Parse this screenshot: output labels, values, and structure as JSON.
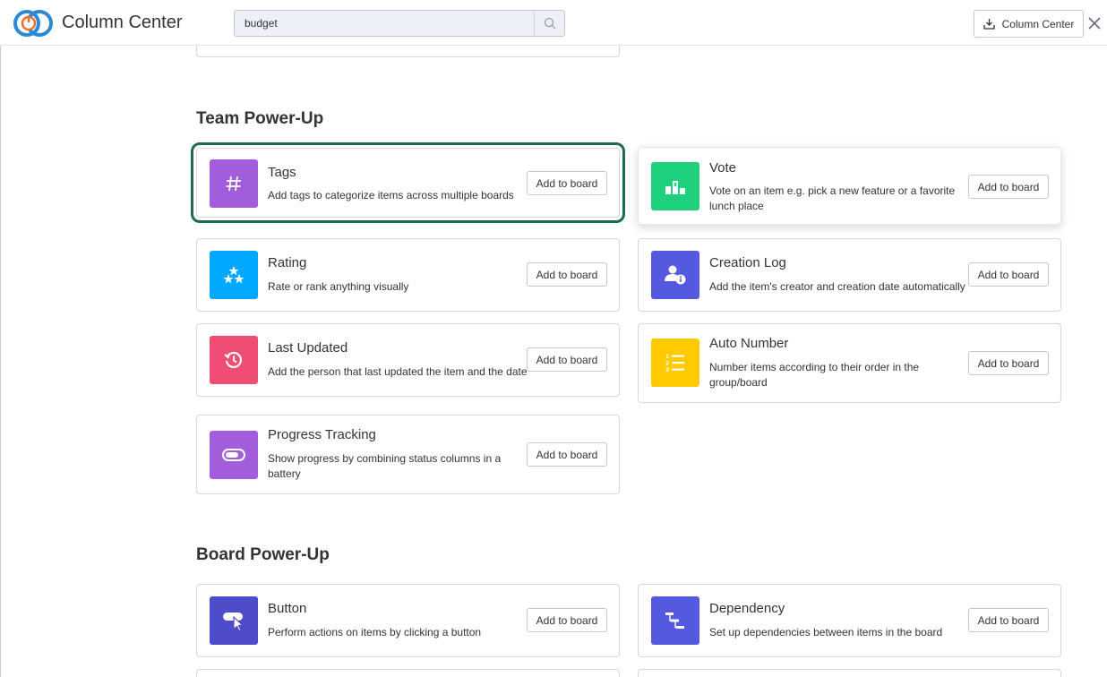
{
  "header": {
    "app_title": "Column Center",
    "search_value": "budget",
    "column_center_button": "Column Center"
  },
  "sections": {
    "team": {
      "title": "Team Power-Up"
    },
    "board": {
      "title": "Board Power-Up"
    }
  },
  "cards": {
    "tags": {
      "title": "Tags",
      "desc": "Add tags to categorize items across multiple boards",
      "button": "Add to board",
      "icon": "hash-icon",
      "color": "#a25ddc"
    },
    "vote": {
      "title": "Vote",
      "desc": "Vote on an item e.g. pick a new feature or a favorite lunch place",
      "button": "Add to board",
      "icon": "podium-icon",
      "color": "#1fd17d"
    },
    "rating": {
      "title": "Rating",
      "desc": "Rate or rank anything visually",
      "button": "Add to board",
      "icon": "stars-icon",
      "color": "#00a9ff"
    },
    "creation_log": {
      "title": "Creation Log",
      "desc": "Add the item's creator and creation date automatically",
      "button": "Add to board",
      "icon": "user-info-icon",
      "color": "#5559df"
    },
    "last_updated": {
      "title": "Last Updated",
      "desc": "Add the person that last updated the item and the date",
      "button": "Add to board",
      "icon": "history-icon",
      "color": "#f04d74"
    },
    "auto_number": {
      "title": "Auto Number",
      "desc": "Number items according to their order in the group/board",
      "button": "Add to board",
      "icon": "numbered-list-icon",
      "color": "#ffcb00"
    },
    "progress": {
      "title": "Progress Tracking",
      "desc": "Show progress by combining status columns in a battery",
      "button": "Add to board",
      "icon": "battery-icon",
      "color": "#a25ddc"
    },
    "button": {
      "title": "Button",
      "desc": "Perform actions on items by clicking a button",
      "button": "Add to board",
      "icon": "click-icon",
      "color": "#4e4cc9"
    },
    "dependency": {
      "title": "Dependency",
      "desc": "Set up dependencies between items in the board",
      "button": "Add to board",
      "icon": "gantt-icon",
      "color": "#5559df"
    }
  }
}
